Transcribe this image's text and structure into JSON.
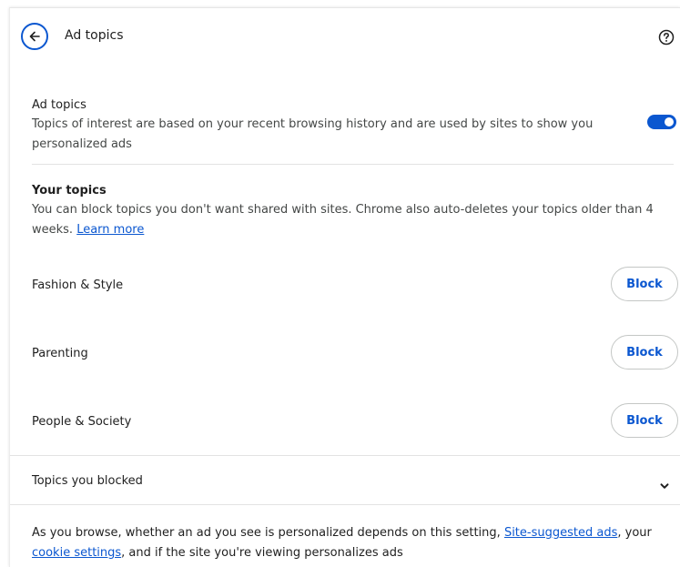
{
  "header": {
    "title": "Ad topics",
    "back_icon": "arrow-back-icon",
    "help_icon": "help-circle-icon"
  },
  "ad_topics_setting": {
    "label": "Ad topics",
    "description": "Topics of interest are based on your recent browsing history and are used by sites to show you personalized ads",
    "toggle_on": true
  },
  "your_topics": {
    "heading": "Your topics",
    "description": "You can block topics you don't want shared with sites. Chrome also auto-deletes your topics older than 4 weeks.",
    "learn_more": "Learn more"
  },
  "topics": [
    {
      "label": "Fashion & Style",
      "button": "Block"
    },
    {
      "label": "Parenting",
      "button": "Block"
    },
    {
      "label": "People & Society",
      "button": "Block"
    }
  ],
  "blocked_section": {
    "label": "Topics you blocked",
    "expand_icon": "chevron-down-icon"
  },
  "footer": {
    "text_1": "As you browse, whether an ad you see is personalized depends on this setting,",
    "link_1": "Site-suggested ads",
    "text_2": ", your",
    "link_2": "cookie settings",
    "text_3": ", and if the site you're viewing personalizes ads"
  },
  "colors": {
    "accent": "#0b57d0",
    "divider": "#e3e3e3",
    "text": "#1f1f1f"
  }
}
